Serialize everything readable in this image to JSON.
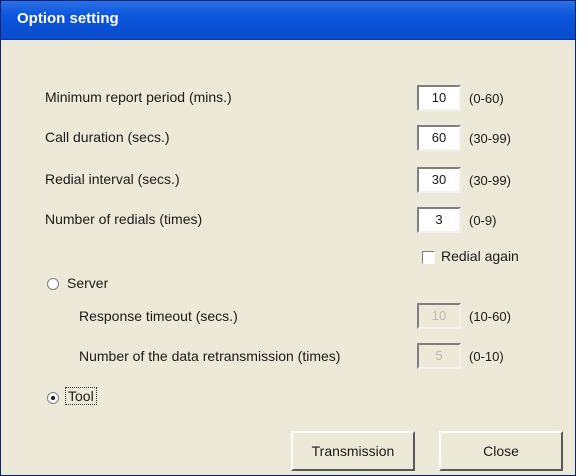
{
  "window": {
    "title": "Option setting"
  },
  "fields": [
    {
      "label": "Minimum report period (mins.)",
      "value": "10",
      "range": "(0-60)"
    },
    {
      "label": "Call duration (secs.)",
      "value": "60",
      "range": "(30-99)"
    },
    {
      "label": "Redial interval (secs.)",
      "value": "30",
      "range": "(30-99)"
    },
    {
      "label": "Number of redials (times)",
      "value": "3",
      "range": "(0-9)"
    }
  ],
  "redial_again": {
    "label": "Redial again",
    "checked": false
  },
  "server": {
    "label": "Server",
    "selected": false,
    "fields": [
      {
        "label": "Response timeout (secs.)",
        "value": "10",
        "range": "(10-60)"
      },
      {
        "label": "Number of the data retransmission (times)",
        "value": "5",
        "range": "(0-10)"
      }
    ]
  },
  "tool": {
    "label": "Tool",
    "selected": true
  },
  "buttons": {
    "transmission": "Transmission",
    "close": "Close"
  }
}
